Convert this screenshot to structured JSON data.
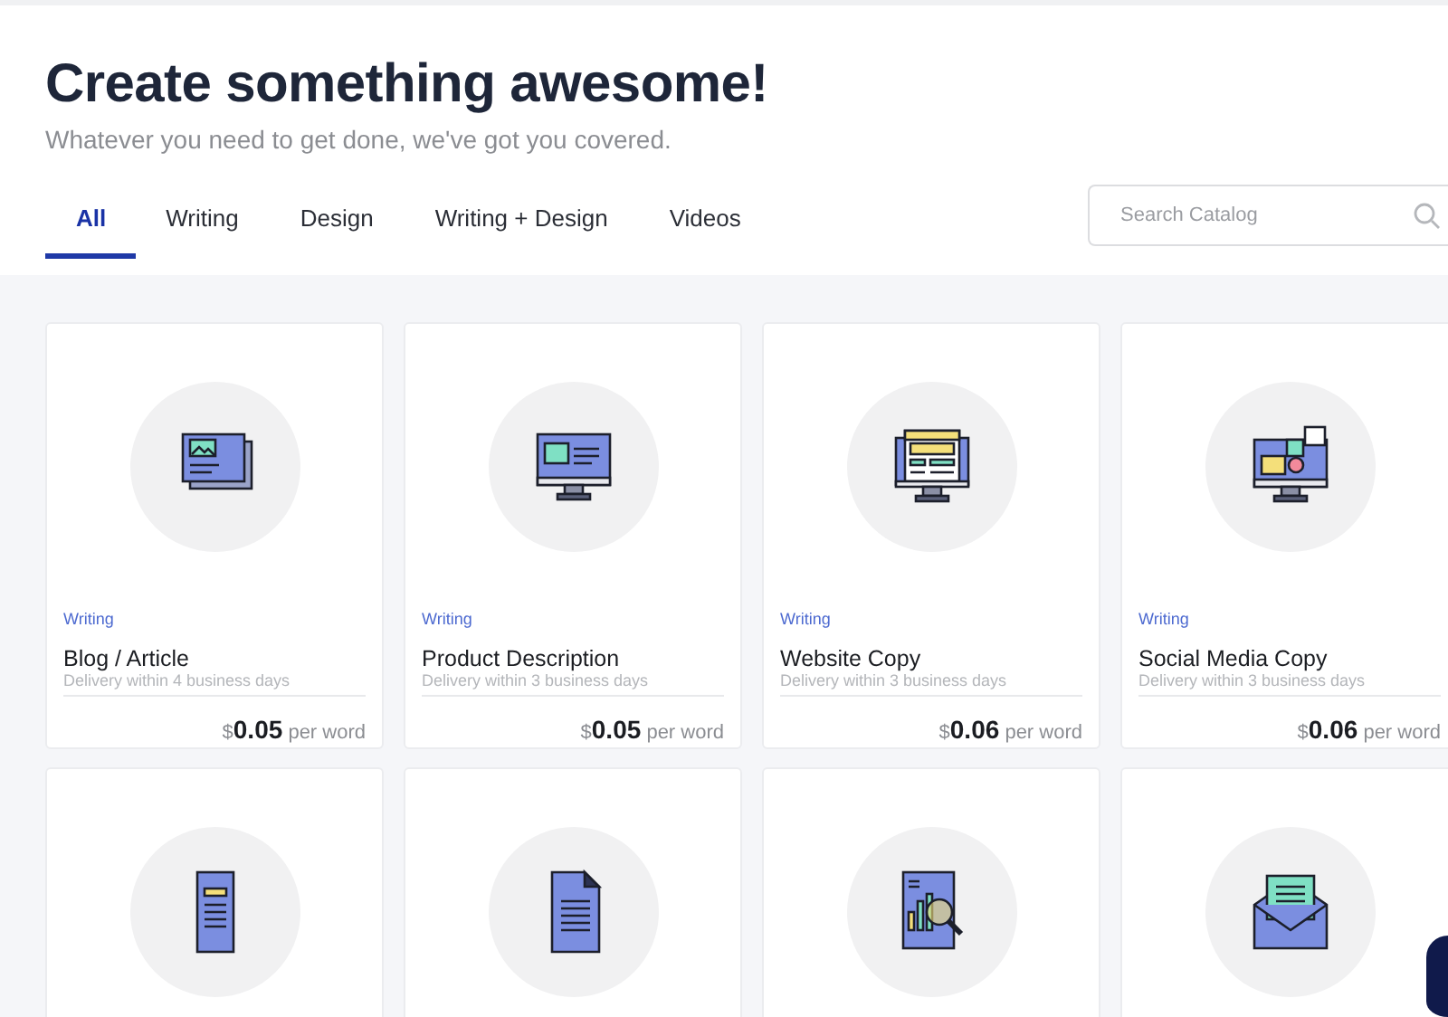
{
  "header": {
    "title": "Create something awesome!",
    "subtitle": "Whatever you need to get done, we've got you covered."
  },
  "tabs": [
    {
      "label": "All",
      "selected": true
    },
    {
      "label": "Writing",
      "selected": false
    },
    {
      "label": "Design",
      "selected": false
    },
    {
      "label": "Writing + Design",
      "selected": false
    },
    {
      "label": "Videos",
      "selected": false
    }
  ],
  "search": {
    "placeholder": "Search Catalog"
  },
  "cards": [
    {
      "kind": "image-cards",
      "category": "Writing",
      "title": "Blog / Article",
      "delivery": "Delivery within 4 business days",
      "currency": "$",
      "price": "0.05",
      "unit": "per word"
    },
    {
      "kind": "monitor",
      "category": "Writing",
      "title": "Product Description",
      "delivery": "Delivery within 3 business days",
      "currency": "$",
      "price": "0.05",
      "unit": "per word"
    },
    {
      "kind": "website",
      "category": "Writing",
      "title": "Website Copy",
      "delivery": "Delivery within 3 business days",
      "currency": "$",
      "price": "0.06",
      "unit": "per word"
    },
    {
      "kind": "social",
      "category": "Writing",
      "title": "Social Media Copy",
      "delivery": "Delivery within 3 business days",
      "currency": "$",
      "price": "0.06",
      "unit": "per word"
    },
    {
      "kind": "phone"
    },
    {
      "kind": "document"
    },
    {
      "kind": "report"
    },
    {
      "kind": "envelope"
    }
  ]
}
